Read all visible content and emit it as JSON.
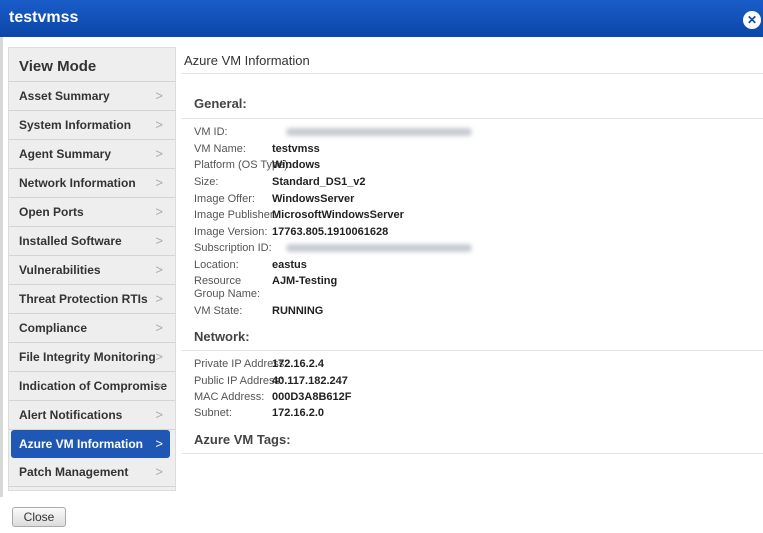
{
  "window": {
    "title": "testvmss"
  },
  "sidebar": {
    "heading": "View Mode",
    "items": [
      {
        "label": "Asset Summary"
      },
      {
        "label": "System Information"
      },
      {
        "label": "Agent Summary"
      },
      {
        "label": "Network Information"
      },
      {
        "label": "Open Ports"
      },
      {
        "label": "Installed Software"
      },
      {
        "label": "Vulnerabilities"
      },
      {
        "label": "Threat Protection RTIs"
      },
      {
        "label": "Compliance"
      },
      {
        "label": "File Integrity Monitoring"
      },
      {
        "label": "Indication of Compromise"
      },
      {
        "label": "Alert Notifications"
      },
      {
        "label": "Azure VM Information"
      },
      {
        "label": "Patch Management"
      }
    ],
    "active_index": 12,
    "chevron": ">"
  },
  "panel": {
    "title": "Azure VM Information",
    "general": {
      "heading": "General:",
      "vm_id_label": "VM ID:",
      "vm_name_label": "VM Name:",
      "vm_name": "testvmss",
      "platform_label": "Platform (OS Type):",
      "platform": "Windows",
      "size_label": "Size:",
      "size": "Standard_DS1_v2",
      "offer_label": "Image Offer:",
      "offer": "WindowsServer",
      "publisher_label": "Image Publisher:",
      "publisher": "MicrosoftWindowsServer",
      "version_label": "Image Version:",
      "version": "17763.805.1910061628",
      "subscription_label": "Subscription ID:",
      "location_label": "Location:",
      "location": "eastus",
      "rg_label": "Resource Group Name:",
      "rg": "AJM-Testing",
      "state_label": "VM State:",
      "state": "RUNNING"
    },
    "network": {
      "heading": "Network:",
      "private_label": "Private IP Address:",
      "private": "172.16.2.4",
      "public_label": "Public IP Address:",
      "public": "40.117.182.247",
      "mac_label": "MAC Address:",
      "mac": "000D3A8B612F",
      "subnet_label": "Subnet:",
      "subnet": "172.16.2.0"
    },
    "tags": {
      "heading": "Azure VM Tags:"
    }
  },
  "footer": {
    "close_label": "Close"
  },
  "icons": {
    "close": "close-icon",
    "chevron": "chevron-right-icon"
  },
  "colors": {
    "titlebar": "#0b47a8",
    "active_item": "#1f57b5"
  }
}
